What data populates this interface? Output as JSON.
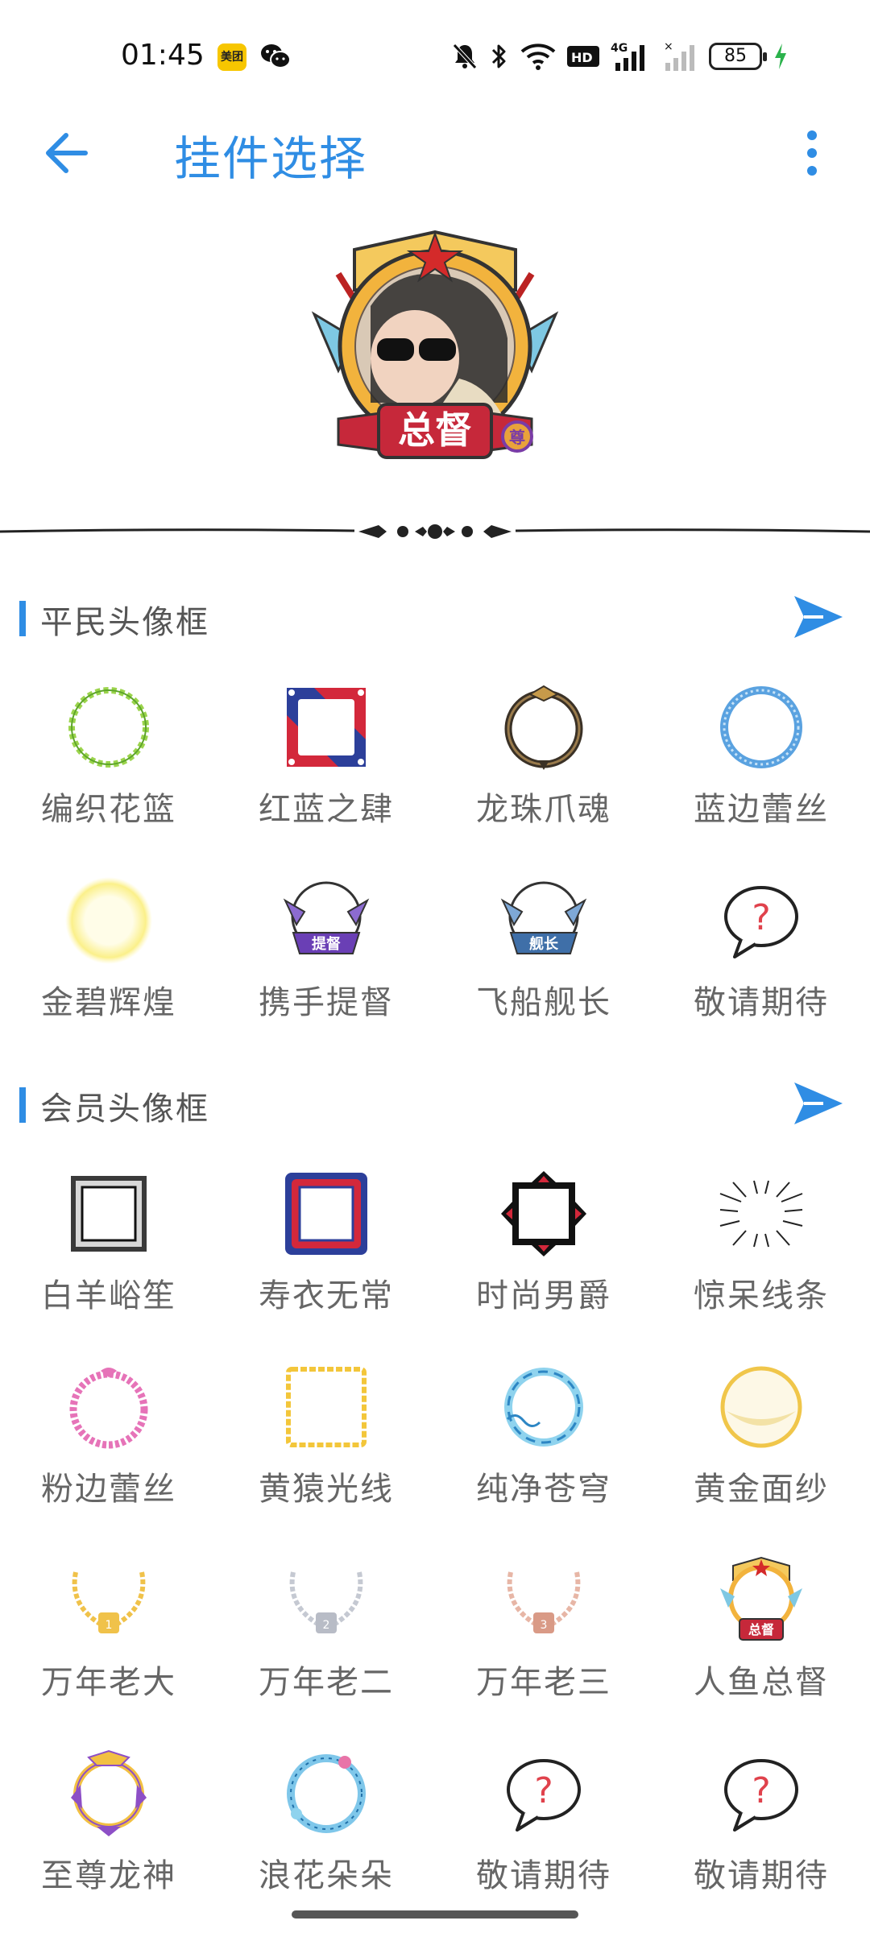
{
  "status_bar": {
    "time": "01:45",
    "meituan_badge": "美团",
    "battery": "85"
  },
  "app_bar": {
    "title": "挂件选择"
  },
  "preview": {
    "badge_text": "总督",
    "small_badge": "尊"
  },
  "sections": [
    {
      "title": "平民头像框",
      "items": [
        {
          "label": "编织花篮",
          "icon": "green-braid-ring-icon"
        },
        {
          "label": "红蓝之肆",
          "icon": "red-blue-square-frame-icon"
        },
        {
          "label": "龙珠爪魂",
          "icon": "dragon-claw-ring-icon"
        },
        {
          "label": "蓝边蕾丝",
          "icon": "blue-lace-ring-icon"
        },
        {
          "label": "金碧辉煌",
          "icon": "golden-glow-ring-icon"
        },
        {
          "label": "携手提督",
          "icon": "admiral-badge-frame-icon",
          "badge": "提督"
        },
        {
          "label": "飞船舰长",
          "icon": "captain-badge-frame-icon",
          "badge": "舰长"
        },
        {
          "label": "敬请期待",
          "icon": "question-bubble-icon"
        }
      ]
    },
    {
      "title": "会员头像框",
      "items": [
        {
          "label": "白羊峪笙",
          "icon": "silver-square-frame-icon"
        },
        {
          "label": "寿衣无常",
          "icon": "ornate-red-blue-frame-icon"
        },
        {
          "label": "时尚男爵",
          "icon": "black-red-cross-frame-icon"
        },
        {
          "label": "惊呆线条",
          "icon": "manga-lines-frame-icon"
        },
        {
          "label": "粉边蕾丝",
          "icon": "pink-lace-ring-icon"
        },
        {
          "label": "黄猿光线",
          "icon": "yellow-square-frame-icon"
        },
        {
          "label": "纯净苍穹",
          "icon": "sky-wave-ring-icon"
        },
        {
          "label": "黄金面纱",
          "icon": "golden-veil-ring-icon"
        },
        {
          "label": "万年老大",
          "icon": "gold-laurel-icon"
        },
        {
          "label": "万年老二",
          "icon": "silver-laurel-icon"
        },
        {
          "label": "万年老三",
          "icon": "bronze-laurel-icon"
        },
        {
          "label": "人鱼总督",
          "icon": "governor-shield-frame-icon",
          "badge": "总督"
        },
        {
          "label": "至尊龙神",
          "icon": "supreme-dragon-frame-icon"
        },
        {
          "label": "浪花朵朵",
          "icon": "wave-flower-ring-icon"
        },
        {
          "label": "敬请期待",
          "icon": "question-bubble-icon"
        },
        {
          "label": "敬请期待",
          "icon": "question-bubble-icon"
        }
      ]
    }
  ],
  "colors": {
    "accent": "#2f8de4",
    "label": "#666666"
  }
}
